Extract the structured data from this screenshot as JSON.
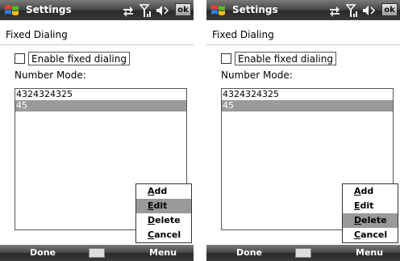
{
  "screens": [
    {
      "title_bar": {
        "title": "Settings",
        "ok_label": "ok"
      },
      "page_title": "Fixed Dialing",
      "enable_checkbox": {
        "label": "Enable fixed dialing",
        "checked": false
      },
      "number_mode_label": "Number Mode:",
      "numbers": [
        {
          "value": "4324324325",
          "selected": false
        },
        {
          "value": "45",
          "selected": true
        }
      ],
      "menu": {
        "items": [
          {
            "accel": "A",
            "rest": "dd",
            "selected": false
          },
          {
            "accel": "E",
            "rest": "dit",
            "selected": true
          },
          {
            "accel": "D",
            "rest": "elete",
            "selected": false
          },
          {
            "accel": "C",
            "rest": "ancel",
            "selected": false
          }
        ]
      },
      "softkeys": {
        "left": "Done",
        "right": "Menu"
      }
    },
    {
      "title_bar": {
        "title": "Settings",
        "ok_label": "ok"
      },
      "page_title": "Fixed Dialing",
      "enable_checkbox": {
        "label": "Enable fixed dialing",
        "checked": false
      },
      "number_mode_label": "Number Mode:",
      "numbers": [
        {
          "value": "4324324325",
          "selected": false
        },
        {
          "value": "45",
          "selected": true
        }
      ],
      "menu": {
        "items": [
          {
            "accel": "A",
            "rest": "dd",
            "selected": false
          },
          {
            "accel": "E",
            "rest": "dit",
            "selected": false
          },
          {
            "accel": "D",
            "rest": "elete",
            "selected": true
          },
          {
            "accel": "C",
            "rest": "ancel",
            "selected": false
          }
        ]
      },
      "softkeys": {
        "left": "Done",
        "right": "Menu"
      }
    }
  ],
  "icons": {
    "start": "windows-start-icon",
    "sync": "activesync-icon",
    "signal": "signal-strength-icon",
    "volume": "speaker-icon",
    "keyboard": "keyboard-icon"
  }
}
